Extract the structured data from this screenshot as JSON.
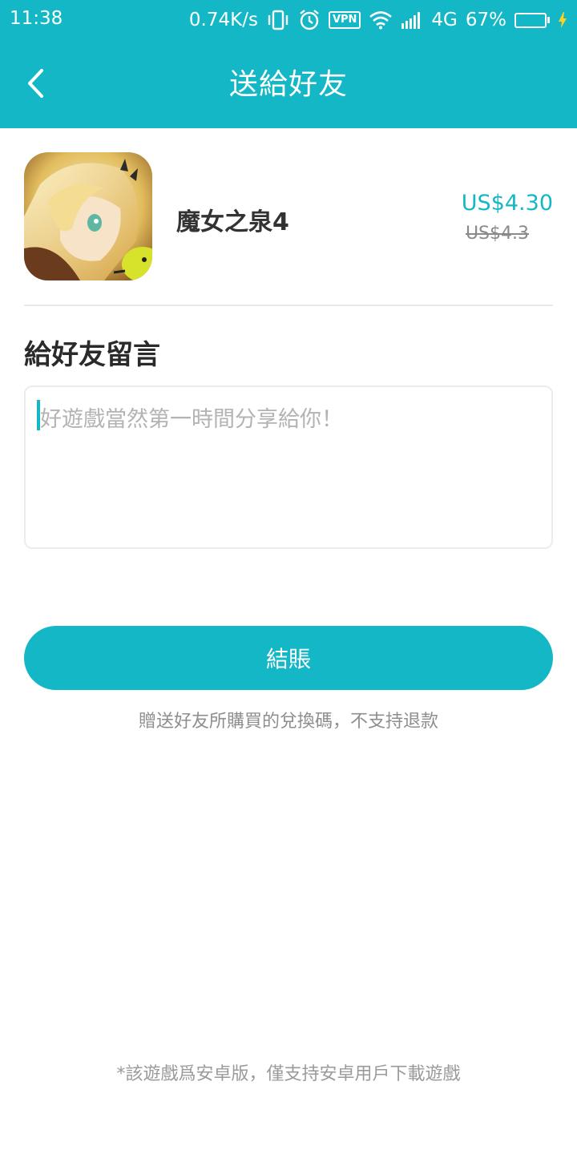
{
  "status_bar": {
    "time": "11:38",
    "speed": "0.74K/s",
    "vpn": "VPN",
    "network": "4G",
    "battery_percent": "67%",
    "battery_level": 0.67,
    "icons": [
      "vibrate-icon",
      "alarm-icon",
      "vpn-icon",
      "wifi-icon",
      "signal-icon",
      "battery-icon",
      "charging-icon"
    ]
  },
  "header": {
    "title": "送給好友",
    "back_icon": "chevron-left-icon",
    "background_color": "#14b7c6"
  },
  "product": {
    "name": "魔女之泉4",
    "price": "US$4.30",
    "original_price": "US$4.3"
  },
  "message": {
    "section_title": "給好友留言",
    "placeholder": "好遊戲當然第一時間分享給你！"
  },
  "checkout": {
    "label": "結賬",
    "note": "贈送好友所購買的兌換碼，不支持退款"
  },
  "footer": {
    "note": "*該遊戲爲安卓版，僅支持安卓用戶下載遊戲"
  },
  "colors": {
    "accent": "#14b7c6",
    "battery_fill": "#3ddc6a"
  }
}
